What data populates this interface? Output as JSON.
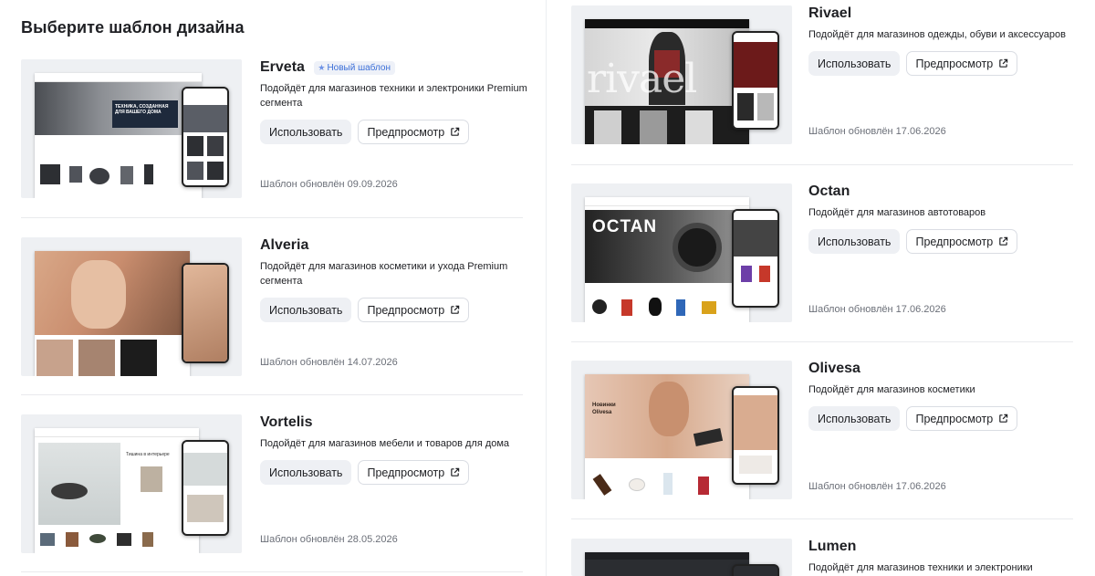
{
  "page_title": "Выберите шаблон дизайна",
  "buttons": {
    "use_label": "Использовать",
    "preview_label": "Предпросмотр"
  },
  "badge_new": "Новый шаблон",
  "left_templates": [
    {
      "name": "Erveta",
      "desc": "Подойдёт для магазинов техники и электроники Premium сегмента",
      "updated": "Шаблон обновлён 09.09.2026",
      "new": true
    },
    {
      "name": "Alveria",
      "desc": "Подойдёт для магазинов косметики и ухода Premium сегмента",
      "updated": "Шаблон обновлён 14.07.2026"
    },
    {
      "name": "Vortelis",
      "desc": "Подойдёт для магазинов мебели и товаров для дома",
      "updated": "Шаблон обновлён 28.05.2026"
    }
  ],
  "right_templates": [
    {
      "name": "Rivael",
      "desc": "Подойдёт для магазинов одежды, обуви и аксессуаров",
      "updated": "Шаблон обновлён 17.06.2026"
    },
    {
      "name": "Octan",
      "desc": "Подойдёт для магазинов автотоваров",
      "updated": "Шаблон обновлён 17.06.2026"
    },
    {
      "name": "Olivesa",
      "desc": "Подойдёт для магазинов косметики",
      "updated": "Шаблон обновлён 17.06.2026"
    },
    {
      "name": "Lumen",
      "desc": "Подойдёт для магазинов техники и электроники"
    }
  ],
  "thumb_text": {
    "erveta_hero": "ТЕХНИКА, СОЗДАННАЯ ДЛЯ ВАШЕГО ДОМА",
    "rivael_logo": "rivael",
    "octan_hero": "OCTAN",
    "olivesa_hero": "Новинки Olivesa",
    "vortelis_hero": "Тишина в интерьере"
  },
  "colors": {
    "accent": "#3b6fd8",
    "panel": "#ffffff",
    "background": "#f2f3f5",
    "muted": "#6b6f78"
  },
  "icons": {
    "external_link": "external-link-icon",
    "star": "star-icon"
  }
}
